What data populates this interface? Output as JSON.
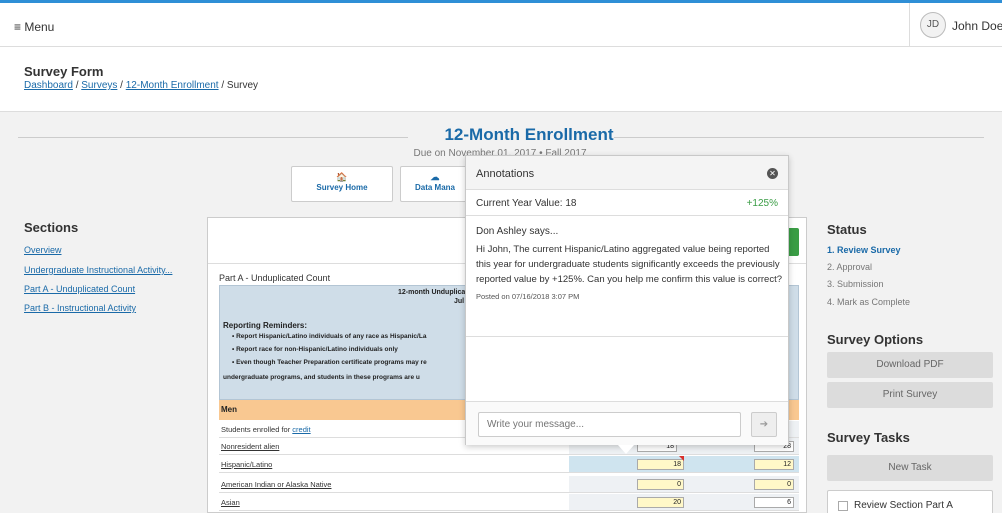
{
  "topbar": {
    "menu_label": "≡ Menu",
    "avatar_initials": "JD",
    "user_name": "John Doe ▾"
  },
  "header": {
    "title": "Survey Form",
    "breadcrumb": [
      "Dashboard",
      "Surveys",
      "12-Month Enrollment",
      "Survey"
    ]
  },
  "survey": {
    "title": "12-Month Enrollment",
    "due": "Due on November 01, 2017  •  Fall 2017"
  },
  "nav_cards": [
    {
      "icon": "home-icon",
      "label": "Survey Home"
    },
    {
      "icon": "cloud-icon",
      "label": "Data Mana"
    }
  ],
  "sections": {
    "heading": "Sections",
    "links": [
      "Overview",
      "Undergraduate Instructional Activity...",
      "Part A - Unduplicated Count",
      "Part B - Instructional Activity"
    ]
  },
  "form": {
    "part_label": "Part A - Unduplicated Count",
    "box_title": "12-month Unduplica",
    "box_subtitle": "Jul",
    "reminders_title": "Reporting Reminders:",
    "reminders": [
      "•  Report Hispanic/Latino individuals of any race as Hispanic/La",
      "•  Report race for non-Hispanic/Latino individuals only",
      "•  Even though Teacher Preparation certificate programs may re",
      "undergraduate programs, and students in these programs are u"
    ],
    "group_label": "Men",
    "students_prefix": "Students enrolled for ",
    "students_link": "credit",
    "rows": [
      {
        "label": "Nonresident alien",
        "v1": "18",
        "v2": "28"
      },
      {
        "label": "Hispanic/Latino",
        "v1": "18",
        "v2": "12"
      },
      {
        "label": "American Indian or Alaska Native",
        "v1": "0",
        "v2": "0"
      },
      {
        "label": "Asian",
        "v1": "20",
        "v2": "6"
      }
    ]
  },
  "annotations": {
    "title": "Annotations",
    "current_label": "Current Year Value: 18",
    "change": "+125%",
    "author_says": "Don Ashley says...",
    "message": "Hi John, The current Hispanic/Latino aggregated value being reported this year for undergraduate students significantly exceeds the previously reported value by +125%. Can you help me confirm this value is correct?",
    "posted": "Posted on 07/16/2018 3:07 PM",
    "input_placeholder": "Write your message..."
  },
  "status": {
    "heading": "Status",
    "steps": [
      "1. Review Survey",
      "2. Approval",
      "3. Submission",
      "4. Mark as Complete"
    ]
  },
  "options": {
    "heading": "Survey Options",
    "download": "Download PDF",
    "print": "Print Survey"
  },
  "tasks": {
    "heading": "Survey Tasks",
    "new_task": "New Task",
    "items": [
      "Review Section Part A"
    ]
  },
  "colors": {
    "accent": "#1a6aa8",
    "topbar_border": "#2f8fd6",
    "positive": "#3a9d45",
    "group_header": "#f9c891",
    "reminder_box": "#cfdde8"
  }
}
